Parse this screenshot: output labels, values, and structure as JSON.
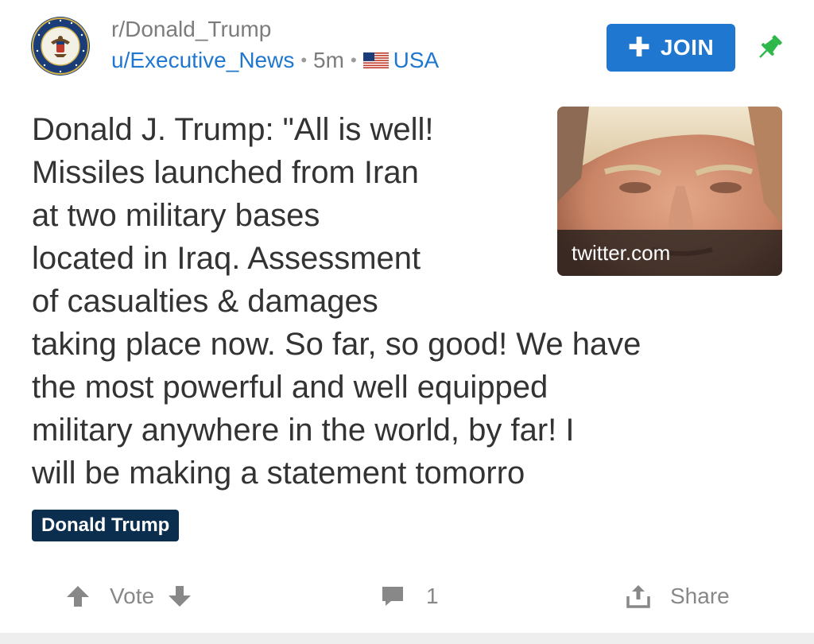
{
  "header": {
    "subreddit": "r/Donald_Trump",
    "user": "u/Executive_News",
    "age": "5m",
    "separator": "•",
    "flag_label": "USA",
    "join_label": "JOIN",
    "join_icon": "plus-icon",
    "pin_icon": "pin-icon",
    "seal_text": "SEAL OF THE PRESIDENT OF THE UNITED STATES"
  },
  "post": {
    "title_lines": [
      "Donald J. Trump: \"All is well!",
      "Missiles launched from Iran",
      "at two military bases",
      "located in Iraq. Assessment",
      "of casualties & damages",
      "taking place now. So far, so good! We have",
      "the most powerful and well equipped",
      "military anywhere in the world, by far! I",
      "will be making a statement tomorro"
    ],
    "thumbnail_caption": "twitter.com",
    "flair": "Donald Trump"
  },
  "actions": {
    "vote_label": "Vote",
    "comment_count": "1",
    "share_label": "Share"
  },
  "colors": {
    "accent": "#1f77d0",
    "flair_bg": "#0c2e4e",
    "pin": "#2fb84a",
    "muted": "#888888"
  }
}
